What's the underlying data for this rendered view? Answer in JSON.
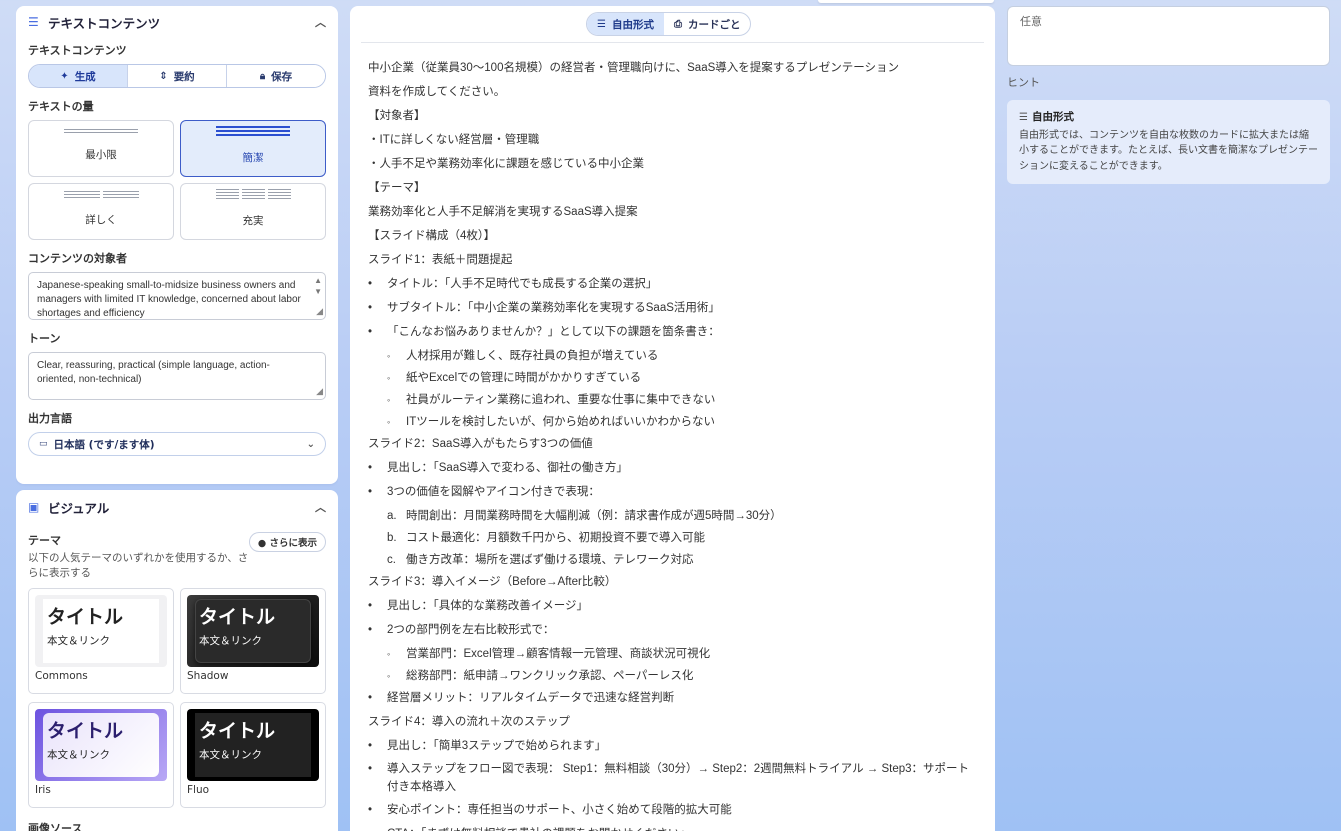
{
  "text_section": {
    "title": "テキストコンテンツ",
    "label": "テキストコンテンツ",
    "actions": [
      {
        "label": "生成",
        "icon": "sparkle-icon"
      },
      {
        "label": "要約",
        "icon": "compress-icon"
      },
      {
        "label": "保存",
        "icon": "lock-icon"
      }
    ],
    "amount_label": "テキストの量",
    "amount_options": [
      "最小限",
      "簡潔",
      "詳しく",
      "充実"
    ],
    "amount_selected": "簡潔",
    "audience_label": "コンテンツの対象者",
    "audience_value": "Japanese-speaking small-to-midsize business owners and managers with limited IT knowledge, concerned about labor shortages and efficiency",
    "tone_label": "トーン",
    "tone_value": "Clear, reassuring, practical (simple language, action-oriented, non-technical)",
    "language_label": "出力言語",
    "language_value": "日本語 (です/ます体)"
  },
  "visual_section": {
    "title": "ビジュアル",
    "theme_label": "テーマ",
    "theme_desc": "以下の人気テーマのいずれかを使用するか、さらに表示する",
    "more_label": "さらに表示",
    "themes": [
      {
        "name": "Commons",
        "title": "タイトル",
        "body": "本文＆リンク"
      },
      {
        "name": "Shadow",
        "title": "タイトル",
        "body": "本文＆リンク"
      },
      {
        "name": "Iris",
        "title": "タイトル",
        "body": "本文＆リンク"
      },
      {
        "name": "Fluo",
        "title": "タイトル",
        "body": "本文＆リンク"
      }
    ],
    "image_source_label": "画像ソース"
  },
  "editor": {
    "modes": [
      {
        "label": "自由形式",
        "icon": "list-icon"
      },
      {
        "label": "カードごと",
        "icon": "card-icon"
      }
    ],
    "active_mode": "自由形式",
    "lines": [
      {
        "t": "p",
        "text": "中小企業（従業員30〜100名規模）の経営者・管理職向けに、SaaS導入を提案するプレゼンテーション"
      },
      {
        "t": "p",
        "text": "資料を作成してください。"
      },
      {
        "t": "p",
        "text": "【対象者】"
      },
      {
        "t": "p",
        "text": "・ITに詳しくない経営層・管理職"
      },
      {
        "t": "p",
        "text": "・人手不足や業務効率化に課題を感じている中小企業"
      },
      {
        "t": "p",
        "text": "【テーマ】"
      },
      {
        "t": "p",
        "text": "業務効率化と人手不足解消を実現するSaaS導入提案"
      },
      {
        "t": "p",
        "text": "【スライド構成（4枚）】"
      },
      {
        "t": "p",
        "text": "スライド1：表紙＋問題提起"
      },
      {
        "t": "b",
        "text": "タイトル：「人手不足時代でも成長する企業の選択」"
      },
      {
        "t": "b",
        "text": "サブタイトル：「中小企業の業務効率化を実現するSaaS活用術」"
      },
      {
        "t": "b",
        "text": "「こんなお悩みありませんか？」として以下の課題を箇条書き："
      },
      {
        "t": "c",
        "m": "◦",
        "text": "人材採用が難しく、既存社員の負担が増えている"
      },
      {
        "t": "c",
        "m": "◦",
        "text": "紙やExcelでの管理に時間がかかりすぎている"
      },
      {
        "t": "c",
        "m": "◦",
        "text": "社員がルーティン業務に追われ、重要な仕事に集中できない"
      },
      {
        "t": "c",
        "m": "◦",
        "text": "ITツールを検討したいが、何から始めればいいかわからない"
      },
      {
        "t": "p",
        "text": "スライド2：SaaS導入がもたらす3つの価値"
      },
      {
        "t": "b",
        "text": "見出し：「SaaS導入で変わる、御社の働き方」"
      },
      {
        "t": "b",
        "text": "3つの価値を図解やアイコン付きで表現："
      },
      {
        "t": "c",
        "m": "a.",
        "text": "時間創出：月間業務時間を大幅削減（例：請求書作成が週5時間→30分）"
      },
      {
        "t": "c",
        "m": "b.",
        "text": "コスト最適化：月額数千円から、初期投資不要で導入可能"
      },
      {
        "t": "c",
        "m": "c.",
        "text": "働き方改革：場所を選ばず働ける環境、テレワーク対応"
      },
      {
        "t": "p",
        "text": "スライド3：導入イメージ（Before→After比較）"
      },
      {
        "t": "b",
        "text": "見出し：「具体的な業務改善イメージ」"
      },
      {
        "t": "b",
        "text": "2つの部門例を左右比較形式で："
      },
      {
        "t": "c",
        "m": "◦",
        "text": "営業部門：Excel管理→顧客情報一元管理、商談状況可視化"
      },
      {
        "t": "c",
        "m": "◦",
        "text": "総務部門：紙申請→ワンクリック承認、ペーパーレス化"
      },
      {
        "t": "b",
        "text": "経営層メリット：リアルタイムデータで迅速な経営判断"
      },
      {
        "t": "p",
        "text": "スライド4：導入の流れ＋次のステップ"
      },
      {
        "t": "b",
        "text": "見出し：「簡単3ステップで始められます」"
      },
      {
        "t": "b2",
        "text": "導入ステップをフロー図で表現： Step1：無料相談（30分）→ Step2：2週間無料トライアル → Step3：サポート付き本格導入"
      },
      {
        "t": "b",
        "text": "安心ポイント：専任担当のサポート、小さく始めて段階的拡大可能"
      },
      {
        "t": "b",
        "text": "CTA：「まずは無料相談で貴社の課題をお聞かせください」"
      }
    ]
  },
  "right": {
    "input_placeholder": "任意",
    "hint_label": "ヒント",
    "hint_title": "自由形式",
    "hint_text": "自由形式では、コンテンツを自由な枚数のカードに拡大または縮小することができます。たとえば、長い文書を簡潔なプレゼンテーションに変えることができます。"
  }
}
